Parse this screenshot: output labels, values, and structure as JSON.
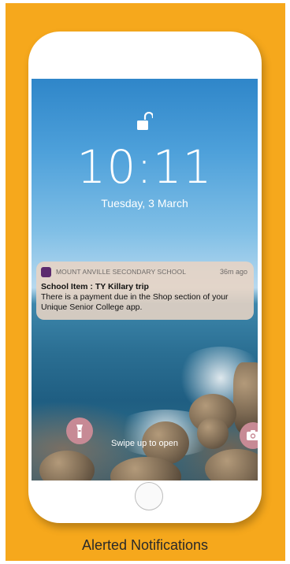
{
  "lockscreen": {
    "time": "10:11",
    "date": "Tuesday, 3 March",
    "swipe_hint": "Swipe up to open"
  },
  "notification": {
    "app_name": "MOUNT ANVILLE SECONDARY SCHOOL",
    "time_ago": "36m ago",
    "title": "School Item : TY Killary trip",
    "body": "There is a payment due in the Shop section of your Unique Senior College app."
  },
  "icons": {
    "lock": "unlocked-padlock-icon",
    "flashlight": "flashlight-icon",
    "camera": "camera-icon"
  },
  "colors": {
    "background": "#f6a81c",
    "shortcut_buttons": "#c78a95",
    "app_icon": "#5b2a6e"
  },
  "caption": "Alerted Notifications"
}
